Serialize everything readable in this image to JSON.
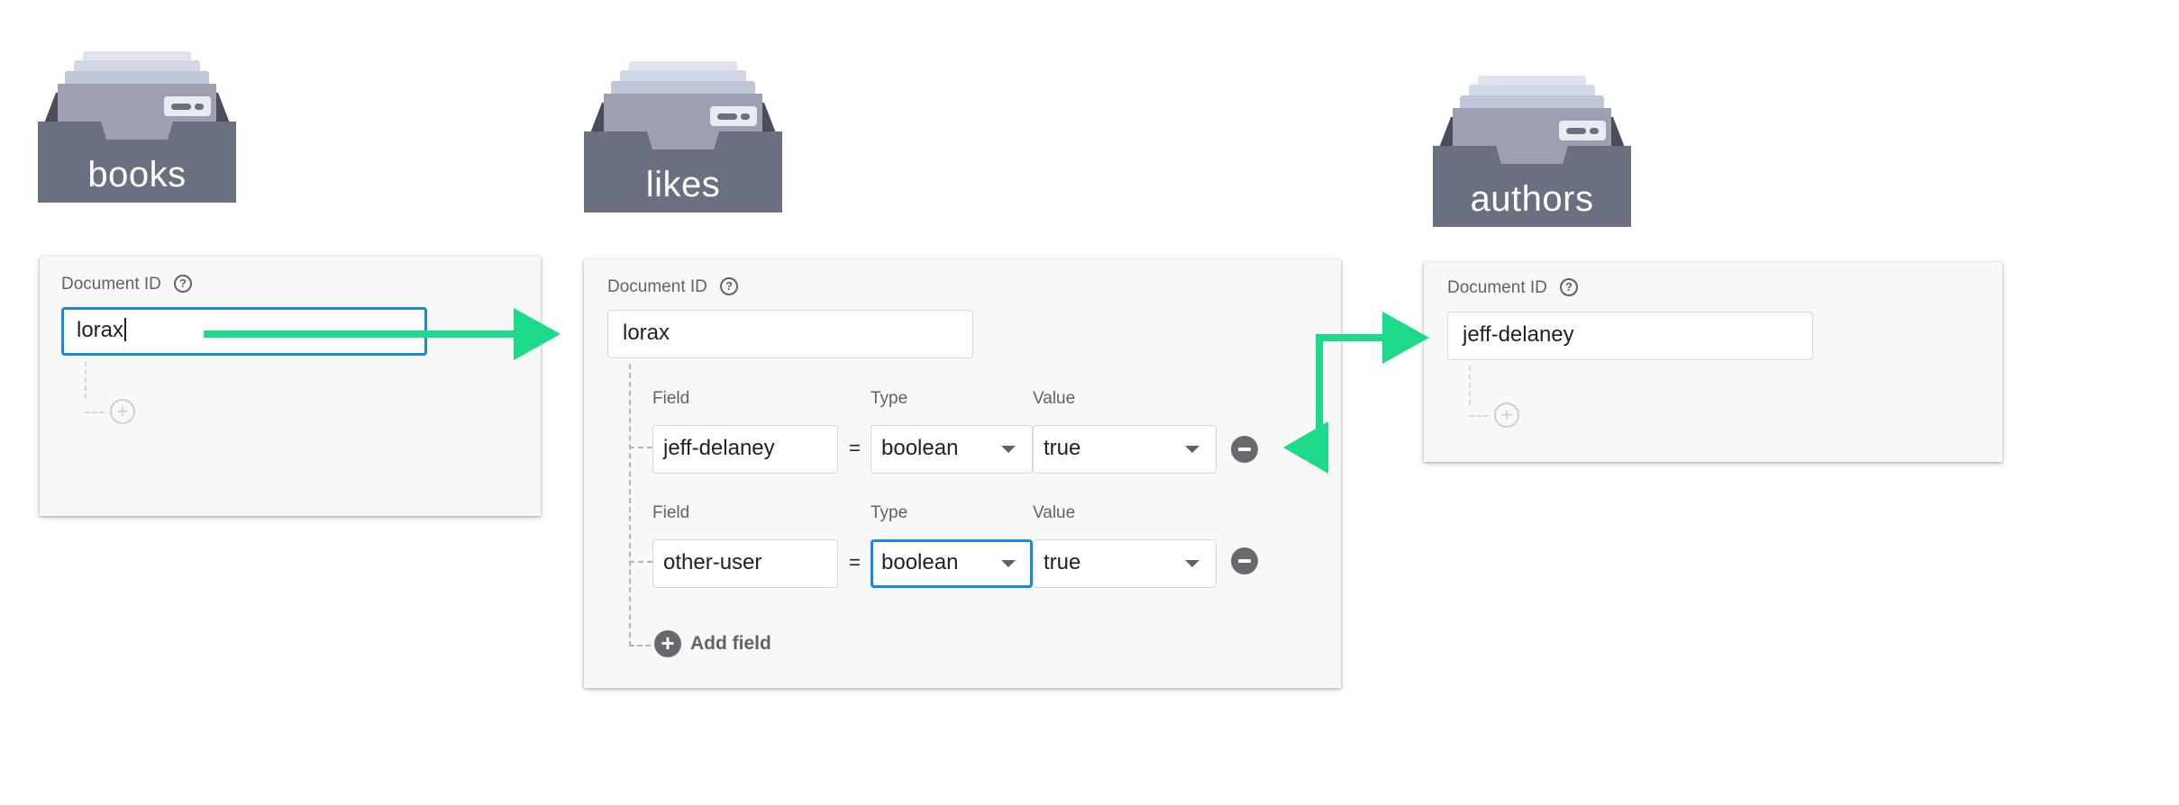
{
  "collections": {
    "books": {
      "name": "books"
    },
    "likes": {
      "name": "likes"
    },
    "authors": {
      "name": "authors"
    }
  },
  "books_card": {
    "document_id_label": "Document ID",
    "document_id_value": "lorax"
  },
  "likes_card": {
    "document_id_label": "Document ID",
    "document_id_value": "lorax",
    "fields": [
      {
        "field_label": "Field",
        "type_label": "Type",
        "value_label": "Value",
        "field": "jeff-delaney",
        "equals": "=",
        "type": "boolean",
        "value": "true"
      },
      {
        "field_label": "Field",
        "type_label": "Type",
        "value_label": "Value",
        "field": "other-user",
        "equals": "=",
        "type": "boolean",
        "value": "true"
      }
    ],
    "add_field_label": "Add field"
  },
  "authors_card": {
    "document_id_label": "Document ID",
    "document_id_value": "jeff-delaney"
  },
  "colors": {
    "arrow": "#1dd98a",
    "focus": "#1a8ad6",
    "drawer": "#6b7080",
    "drawer_dark": "#4a4e5a"
  },
  "icons": {
    "help": "help-circle-icon",
    "remove": "minus-circle-icon",
    "add": "plus-circle-icon",
    "dropdown": "chevron-down-icon",
    "collection": "file-drawer-icon"
  }
}
